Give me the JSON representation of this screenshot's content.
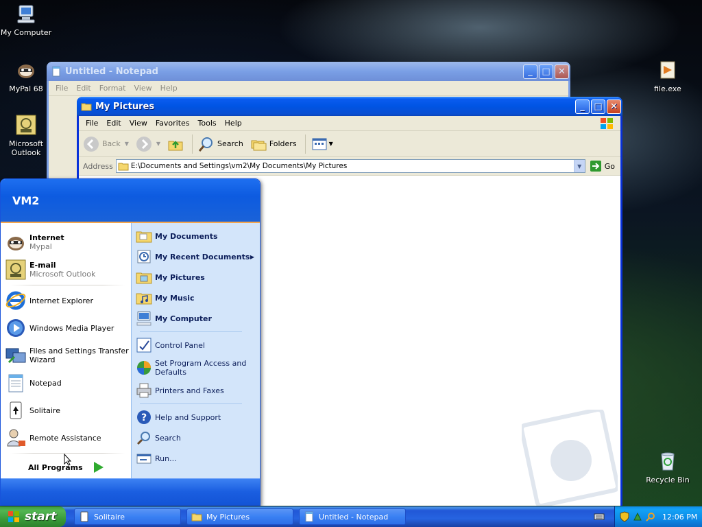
{
  "desktop": {
    "icons": [
      {
        "label": "My Computer"
      },
      {
        "label": "MyPal 68"
      },
      {
        "label": "Microsoft Outlook"
      },
      {
        "label": "file.exe"
      },
      {
        "label": "Recycle Bin"
      }
    ]
  },
  "notepad": {
    "title": "Untitled - Notepad",
    "menu": [
      "File",
      "Edit",
      "Format",
      "View",
      "Help"
    ]
  },
  "pictures": {
    "title": "My Pictures",
    "menu": [
      "File",
      "Edit",
      "View",
      "Favorites",
      "Tools",
      "Help"
    ],
    "toolbar": {
      "back": "Back",
      "search": "Search",
      "folders": "Folders"
    },
    "address": {
      "label": "Address",
      "path": "E:\\Documents and Settings\\vm2\\My Documents\\My Pictures",
      "go": "Go"
    }
  },
  "start_menu": {
    "user": "VM2",
    "pinned": [
      {
        "title": "Internet",
        "subtitle": "Mypal",
        "icon": "mypal-icon"
      },
      {
        "title": "E-mail",
        "subtitle": "Microsoft Outlook",
        "icon": "outlook-icon"
      }
    ],
    "recent": [
      {
        "label": "Internet Explorer"
      },
      {
        "label": "Windows Media Player"
      },
      {
        "label": "Files and Settings Transfer Wizard"
      },
      {
        "label": "Notepad"
      },
      {
        "label": "Solitaire"
      },
      {
        "label": "Remote Assistance"
      }
    ],
    "all_programs": "All Programs",
    "places": [
      {
        "label": "My Documents"
      },
      {
        "label": "My Recent Documents"
      },
      {
        "label": "My Pictures"
      },
      {
        "label": "My Music"
      },
      {
        "label": "My Computer"
      }
    ],
    "settings": [
      {
        "label": "Control Panel"
      },
      {
        "label": "Set Program Access and Defaults"
      },
      {
        "label": "Printers and Faxes"
      }
    ],
    "help": [
      {
        "label": "Help and Support"
      },
      {
        "label": "Search"
      },
      {
        "label": "Run..."
      }
    ]
  },
  "taskbar": {
    "start": "start",
    "tasks": [
      {
        "label": "Solitaire"
      },
      {
        "label": "My Pictures"
      },
      {
        "label": "Untitled - Notepad"
      }
    ],
    "clock": "12:06 PM"
  },
  "colors": {
    "title_active": "#0054e3",
    "start_green": "#3a9c3a",
    "tray_blue": "#0d8be8"
  }
}
